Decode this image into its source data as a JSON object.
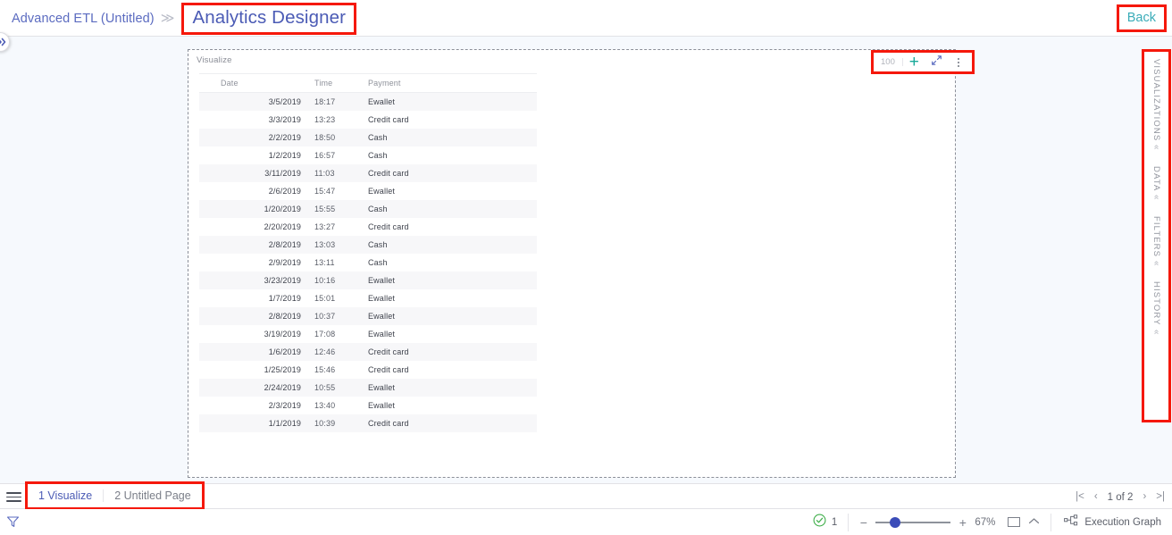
{
  "header": {
    "breadcrumb_parent": "Advanced ETL (Untitled)",
    "breadcrumb_separator": "≫",
    "breadcrumb_current": "Analytics Designer",
    "back_label": "Back",
    "expand_handle_icon": "chevron-double-right-icon"
  },
  "widget": {
    "title": "Visualize",
    "toolbar": {
      "row_count": "100",
      "add_icon": "plus-icon",
      "expand_icon": "expand-arrows-icon",
      "more_icon": "more-vertical-icon"
    },
    "table": {
      "columns": [
        "Date",
        "Time",
        "Payment"
      ],
      "rows": [
        [
          "3/5/2019",
          "18:17",
          "Ewallet"
        ],
        [
          "3/3/2019",
          "13:23",
          "Credit card"
        ],
        [
          "2/2/2019",
          "18:50",
          "Cash"
        ],
        [
          "1/2/2019",
          "16:57",
          "Cash"
        ],
        [
          "3/11/2019",
          "11:03",
          "Credit card"
        ],
        [
          "2/6/2019",
          "15:47",
          "Ewallet"
        ],
        [
          "1/20/2019",
          "15:55",
          "Cash"
        ],
        [
          "2/20/2019",
          "13:27",
          "Credit card"
        ],
        [
          "2/8/2019",
          "13:03",
          "Cash"
        ],
        [
          "2/9/2019",
          "13:11",
          "Cash"
        ],
        [
          "3/23/2019",
          "10:16",
          "Ewallet"
        ],
        [
          "1/7/2019",
          "15:01",
          "Ewallet"
        ],
        [
          "2/8/2019",
          "10:37",
          "Ewallet"
        ],
        [
          "3/19/2019",
          "17:08",
          "Ewallet"
        ],
        [
          "1/6/2019",
          "12:46",
          "Credit card"
        ],
        [
          "1/25/2019",
          "15:46",
          "Credit card"
        ],
        [
          "2/24/2019",
          "10:55",
          "Ewallet"
        ],
        [
          "2/3/2019",
          "13:40",
          "Ewallet"
        ],
        [
          "1/1/2019",
          "10:39",
          "Credit card"
        ]
      ]
    }
  },
  "right_panel": {
    "sections": [
      {
        "label": "VISUALIZATIONS",
        "chevron": "«"
      },
      {
        "label": "DATA",
        "chevron": "«"
      },
      {
        "label": "FILTERS",
        "chevron": "«"
      },
      {
        "label": "HISTORY",
        "chevron": "«"
      }
    ]
  },
  "tabbar": {
    "menu_icon": "hamburger-menu-icon",
    "tabs": [
      {
        "label": "1 Visualize",
        "active": true
      },
      {
        "label": "2 Untitled Page",
        "active": false
      }
    ],
    "pager": {
      "first_icon": "|<",
      "prev_icon": "‹",
      "label": "1 of 2",
      "next_icon": "›",
      "last_icon": ">|"
    }
  },
  "statusbar": {
    "filter_icon": "filter-funnel-icon",
    "status_icon": "check-circle-icon",
    "status_count": "1",
    "zoom": {
      "minus": "−",
      "plus": "+",
      "percent": "67%",
      "fit_icon": "fit-to-screen-icon",
      "collapse_icon": "chevron-up-icon"
    },
    "execution_graph": {
      "icon": "execution-graph-icon",
      "label": "Execution Graph"
    }
  },
  "colors": {
    "accent_blue": "#4b5bb5",
    "teal": "#3aacb8",
    "annotation_red": "#f5180b",
    "canvas_bg": "#f6f9fd",
    "slider_thumb": "#3b4cb8",
    "status_green": "#3fae4a"
  }
}
